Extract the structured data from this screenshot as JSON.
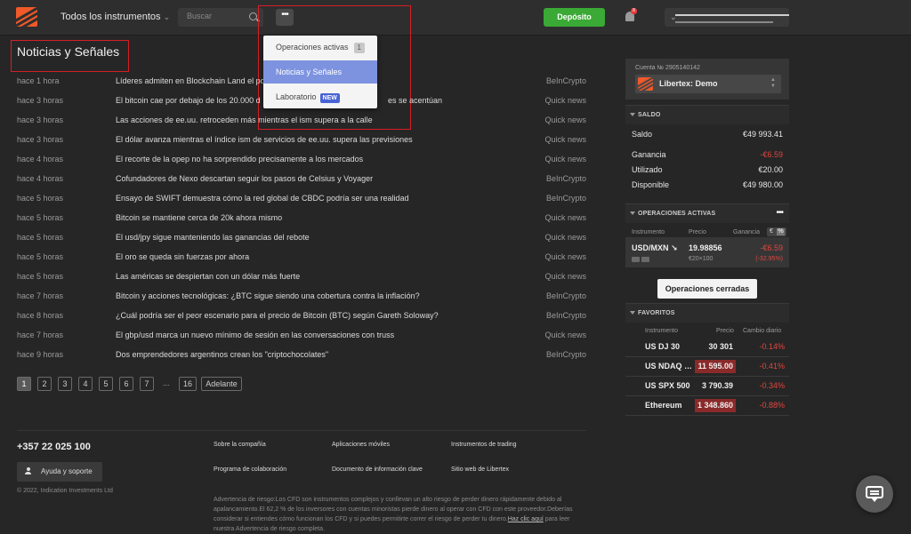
{
  "header": {
    "instruments_label": "Todos los instrumentos",
    "search_placeholder": "Buscar",
    "more_label": "•••",
    "deposit_label": "Depósito",
    "notifications_count": "8"
  },
  "page_title": "Noticias y Señales",
  "menu": {
    "items": [
      {
        "label": "Operaciones activas",
        "count": "1"
      },
      {
        "label": "Noticias y Señales"
      },
      {
        "label": "Laboratorio",
        "tag": "NEW"
      }
    ]
  },
  "news": [
    {
      "time": "hace 1 hora",
      "headline": "Líderes admiten en Blockchain Land el pot",
      "source": "BeInCrypto"
    },
    {
      "time": "hace 3 horas",
      "headline": "El bitcoin cae por debajo de los 20.000 d",
      "headline_tail": "es se acentúan",
      "source": "Quick news"
    },
    {
      "time": "hace 3 horas",
      "headline": "Las acciones de ee.uu. retroceden más mientras el ism supera a la calle",
      "source": "Quick news"
    },
    {
      "time": "hace 3 horas",
      "headline": "El dólar avanza mientras el índice ism de servicios de ee.uu. supera las previsiones",
      "source": "Quick news"
    },
    {
      "time": "hace 4 horas",
      "headline": "El recorte de la opep no ha sorprendido precisamente a los mercados",
      "source": "Quick news"
    },
    {
      "time": "hace 4 horas",
      "headline": "Cofundadores de Nexo descartan seguir los pasos de Celsius y Voyager",
      "source": "BeInCrypto"
    },
    {
      "time": "hace 5 horas",
      "headline": "Ensayo de SWIFT demuestra cómo la red global de CBDC podría ser una realidad",
      "source": "BeInCrypto"
    },
    {
      "time": "hace 5 horas",
      "headline": "Bitcoin se mantiene cerca de 20k ahora mismo",
      "source": "Quick news"
    },
    {
      "time": "hace 5 horas",
      "headline": "El usd/jpy sigue manteniendo las ganancias del rebote",
      "source": "Quick news"
    },
    {
      "time": "hace 5 horas",
      "headline": "El oro se queda sin fuerzas por ahora",
      "source": "Quick news"
    },
    {
      "time": "hace 5 horas",
      "headline": "Las américas se despiertan con un dólar más fuerte",
      "source": "Quick news"
    },
    {
      "time": "hace 7 horas",
      "headline": "Bitcoin y acciones tecnológicas: ¿BTC sigue siendo una cobertura contra la inflación?",
      "source": "BeInCrypto"
    },
    {
      "time": "hace 8 horas",
      "headline": "¿Cuál podría ser el peor escenario para el precio de Bitcoin (BTC) según Gareth Soloway?",
      "source": "BeInCrypto"
    },
    {
      "time": "hace 7 horas",
      "headline": "El gbp/usd marca un nuevo mínimo de sesión en las conversaciones con truss",
      "source": "Quick news"
    },
    {
      "time": "hace 9 horas",
      "headline": "Dos emprendedores argentinos crean los \"criptochocolates\"",
      "source": "BeInCrypto"
    }
  ],
  "pagination": {
    "pages": [
      "1",
      "2",
      "3",
      "4",
      "5",
      "6",
      "7"
    ],
    "ellipsis": "...",
    "last": "16",
    "next": "Adelante"
  },
  "footer": {
    "phone": "+357 22 025 100",
    "help_label": "Ayuda y soporte",
    "copyright": "© 2022, Indication Investments Ltd",
    "links": [
      "Sobre la compañía",
      "Aplicaciones móviles",
      "Instrumentos de trading",
      "Programa de colaboración",
      "Documento de información clave",
      "Sitio web de Libertex"
    ],
    "risk_text": "Advertencia de riesgo:Los CFD son instrumentos complejos y conllevan un alto riesgo de perder dinero rápidamente debido al apalancamiento.El 62,2 % de los inversores con cuentas minoristas pierde dinero al operar con CFD con este proveedor.Deberías considerar si entiendes cómo funcionan los CFD y si puedes permitirte correr el riesgo de perder tu dinero.",
    "risk_link": "Haz clic aquí",
    "risk_tail": " para leer nuestra Advertencia de riesgo completa."
  },
  "account": {
    "number_label": "Cuenta № 2905140142",
    "name": "Libertex: Demo"
  },
  "balance": {
    "section_label": "SALDO",
    "rows": [
      {
        "label": "Saldo",
        "value": "€49 993.41"
      },
      {
        "label": "Ganancia",
        "value": "-€6.59"
      },
      {
        "label": "Utilizado",
        "value": "€20.00"
      },
      {
        "label": "Disponible",
        "value": "€49 980.00"
      }
    ]
  },
  "active_ops": {
    "section_label": "OPERACIONES ACTIVAS",
    "more": "•••",
    "col_instrument": "Instrumento",
    "col_price": "Precio",
    "col_gain": "Ganancia",
    "col_toggle_eur": "€",
    "col_toggle_pct": "%",
    "symbol": "USD/MXN ↘",
    "price": "19.98856",
    "sub": "€20×100",
    "gain": "-€6.59",
    "gain_pct": "(-32.95%)",
    "closed_label": "Operaciones cerradas"
  },
  "favorites": {
    "section_label": "FAVORITOS",
    "col_instrument": "Instrumento",
    "col_price": "Precio",
    "col_change": "Cambio diario",
    "items": [
      {
        "name": "US DJ 30",
        "price": "30 301",
        "change": "-0.14%"
      },
      {
        "name": "US NDAQ 1...",
        "price": "11 595.00",
        "change": "-0.41%"
      },
      {
        "name": "US SPX 500",
        "price": "3 790.39",
        "change": "-0.34%"
      },
      {
        "name": "Ethereum",
        "price": "1 348.860",
        "change": "-0.88%"
      }
    ]
  },
  "colors": {
    "accent_orange": "#f0592a",
    "deposit_green": "#3aa935",
    "negative_red": "#e0473f",
    "menu_active": "#7d93e0",
    "highlight_red": "#d61f26"
  }
}
